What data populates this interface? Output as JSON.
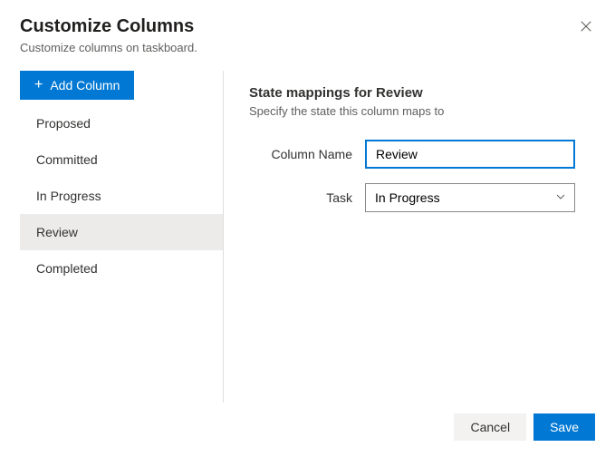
{
  "header": {
    "title": "Customize Columns",
    "subtitle": "Customize columns on taskboard."
  },
  "sidebar": {
    "add_button_label": "Add Column",
    "items": [
      {
        "label": "Proposed",
        "selected": false
      },
      {
        "label": "Committed",
        "selected": false
      },
      {
        "label": "In Progress",
        "selected": false
      },
      {
        "label": "Review",
        "selected": true
      },
      {
        "label": "Completed",
        "selected": false
      }
    ]
  },
  "main": {
    "section_title": "State mappings for Review",
    "section_desc": "Specify the state this column maps to",
    "column_name_label": "Column Name",
    "column_name_value": "Review",
    "task_label": "Task",
    "task_value": "In Progress"
  },
  "footer": {
    "cancel_label": "Cancel",
    "save_label": "Save"
  }
}
